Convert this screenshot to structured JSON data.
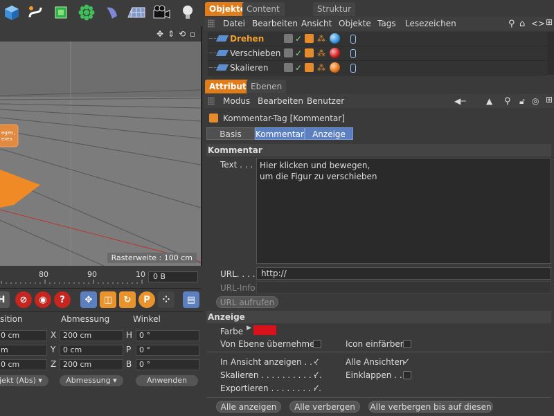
{
  "toolbar": {
    "icons": [
      "cube-icon",
      "spline-pen-icon",
      "generator-icon",
      "array-icon",
      "deformer-icon",
      "floor-icon",
      "camera-icon",
      "light-bulb-icon"
    ]
  },
  "viewport": {
    "raster_label": "Rasterweite : 100 cm",
    "badge_line1": "egen,",
    "badge_line2": "eren"
  },
  "timeline": {
    "ticks": [
      "80",
      "90",
      "10"
    ],
    "frame": "0 B"
  },
  "coords": {
    "col_position": "sition",
    "col_size": "Abmessung",
    "col_angle": "Winkel",
    "rows": [
      {
        "pos": "0 cm",
        "axis": "X",
        "size": "200 cm",
        "rot_axis": "H",
        "rot": "0 °"
      },
      {
        "pos": "m",
        "axis": "Y",
        "size": "0 cm",
        "rot_axis": "P",
        "rot": "0 °"
      },
      {
        "pos": "0 cm",
        "axis": "Z",
        "size": "200 cm",
        "rot_axis": "B",
        "rot": "0 °"
      }
    ],
    "mode_select": "jekt (Abs)",
    "size_select": "Abmessung",
    "apply_button": "Anwenden"
  },
  "tabs_top": [
    "Objekte",
    "Content Browser",
    "Struktur"
  ],
  "objects_menu": [
    "Datei",
    "Bearbeiten",
    "Ansicht",
    "Objekte",
    "Tags",
    "Lesezeichen"
  ],
  "objects": [
    {
      "name": "Drehen",
      "active": true,
      "sphere": "#2f8fd6"
    },
    {
      "name": "Verschieben",
      "active": false,
      "sphere": "#cc1b1b"
    },
    {
      "name": "Skalieren",
      "active": false,
      "sphere": "#e46f14"
    }
  ],
  "attr_tabs": [
    "Attribute",
    "Ebenen"
  ],
  "attr_menu": [
    "Modus",
    "Bearbeiten",
    "Benutzer"
  ],
  "tag_title": "Kommentar-Tag [Kommentar]",
  "sub_tabs": [
    "Basis",
    "Kommentar",
    "Anzeige"
  ],
  "kommentar": {
    "header": "Kommentar",
    "text_label": "Text . . . .",
    "text_value": "Hier klicken und bewegen,\num die Figur zu verschieben",
    "url_label": "URL. . . . .",
    "url_value": "http://",
    "urlinfo_label": "URL-Info",
    "urlinfo_value": "",
    "url_button": "URL aufrufen"
  },
  "anzeige": {
    "header": "Anzeige",
    "farbe_label": "Farbe",
    "farbe_color": "#d8111b",
    "von_ebene": "Von Ebene übernehmen",
    "icon_einfaerben": "Icon einfärben",
    "in_ansicht": "In Ansicht anzeigen . . .",
    "alle_ansichten": "Alle Ansichten",
    "skalieren": "Skalieren . . . . . . . . . . . .",
    "einklappen": "Einklappen . . .",
    "exportieren": "Exportieren . . . . . . . . . ."
  },
  "bottom_buttons": [
    "Alle anzeigen",
    "Alle verbergen",
    "Alle verbergen bis auf diesen"
  ]
}
